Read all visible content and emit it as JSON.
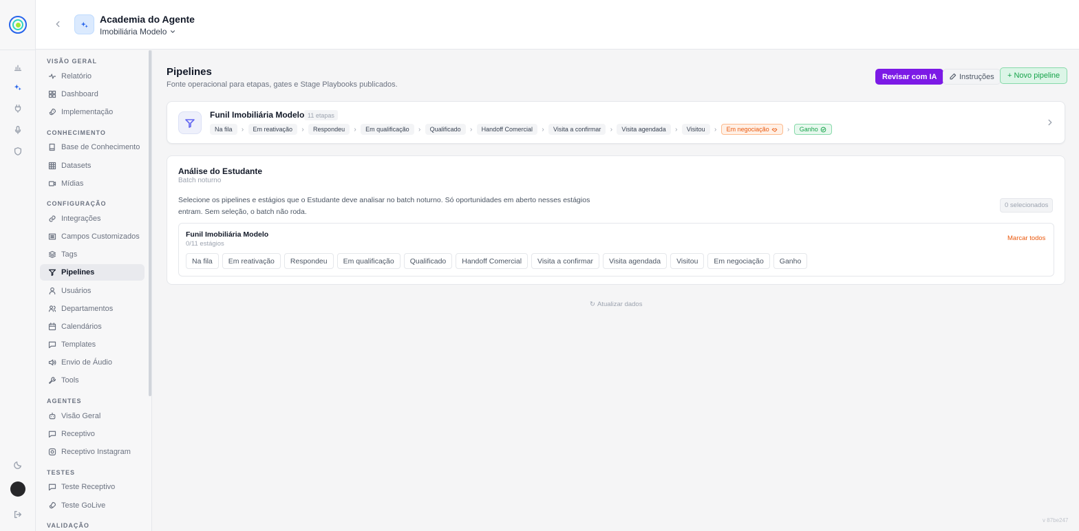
{
  "header": {
    "agent_name": "Academia do Agente",
    "tenant": "Imobiliária Modelo"
  },
  "sidebar": {
    "sections": {
      "overview": "VISÃO GERAL",
      "knowledge": "CONHECIMENTO",
      "config": "CONFIGURAÇÃO",
      "agents": "AGENTES",
      "tests": "TESTES",
      "validation": "VALIDAÇÃO"
    },
    "items": [
      {
        "label": "Relatório",
        "icon": "activity-icon"
      },
      {
        "label": "Dashboard",
        "icon": "grid-icon"
      },
      {
        "label": "Implementação",
        "icon": "rocket-icon"
      },
      {
        "label": "Base de Conhecimento",
        "icon": "book-icon"
      },
      {
        "label": "Datasets",
        "icon": "table-icon"
      },
      {
        "label": "Mídias",
        "icon": "video-icon"
      },
      {
        "label": "Integrações",
        "icon": "link-icon"
      },
      {
        "label": "Campos Customizados",
        "icon": "list-icon"
      },
      {
        "label": "Tags",
        "icon": "layers-icon"
      },
      {
        "label": "Pipelines",
        "icon": "filter-icon"
      },
      {
        "label": "Usuários",
        "icon": "user-icon"
      },
      {
        "label": "Departamentos",
        "icon": "users-icon"
      },
      {
        "label": "Calendários",
        "icon": "calendar-icon"
      },
      {
        "label": "Templates",
        "icon": "message-icon"
      },
      {
        "label": "Envio de Áudio",
        "icon": "speaker-icon"
      },
      {
        "label": "Tools",
        "icon": "wrench-icon"
      },
      {
        "label": "Visão Geral",
        "icon": "bot-icon"
      },
      {
        "label": "Receptivo",
        "icon": "message-icon"
      },
      {
        "label": "Receptivo Instagram",
        "icon": "instagram-icon"
      },
      {
        "label": "Teste Receptivo",
        "icon": "message-icon"
      },
      {
        "label": "Teste GoLive",
        "icon": "rocket-icon"
      }
    ],
    "active": "Pipelines"
  },
  "main": {
    "title": "Pipelines",
    "subtitle": "Fonte operacional para etapas, gates e Stage Playbooks publicados.",
    "btn_ai": "Revisar com IA",
    "btn_instructions": "Instruções",
    "btn_new": "+ Novo pipeline"
  },
  "pipeline": {
    "name": "Funil Imobiliária Modelo",
    "count": "11 etapas",
    "stages": [
      "Na fila",
      "Em reativação",
      "Respondeu",
      "Em qualificação",
      "Qualificado",
      "Handoff Comercial",
      "Visita a confirmar",
      "Visita agendada",
      "Visitou",
      "Em negociação",
      "Ganho"
    ]
  },
  "analysis": {
    "title": "Análise do Estudante",
    "subtitle": "Batch noturno",
    "description": "Selecione os pipelines e estágios que o Estudante deve analisar no batch noturno. Só oportunidades em aberto nesses estágios entram. Sem seleção, o batch não roda.",
    "selected_badge": "0 selecionados",
    "inner_name": "Funil Imobiliária Modelo",
    "inner_count": "0/11 estágios",
    "mark_all": "Marcar todos",
    "stages": [
      "Na fila",
      "Em reativação",
      "Respondeu",
      "Em qualificação",
      "Qualificado",
      "Handoff Comercial",
      "Visita a confirmar",
      "Visita agendada",
      "Visitou",
      "Em negociação",
      "Ganho"
    ]
  },
  "footer": {
    "refresh": "Atualizar dados",
    "refresh_glyph": "↻",
    "version": "v 87be247"
  },
  "colors": {
    "accent_ai": "#7c1ae6",
    "brand_blue": "#2563eb",
    "success": "#16a34a",
    "warning": "#ea580c"
  }
}
